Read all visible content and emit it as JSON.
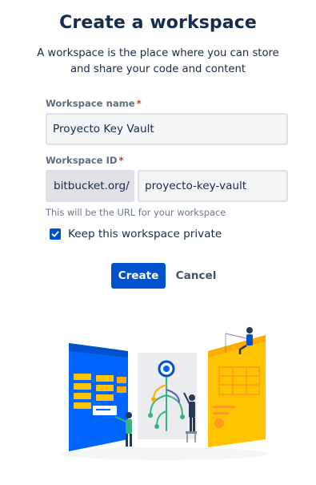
{
  "page": {
    "title": "Create a workspace",
    "subtitle": "A workspace is the place where you can store and share your code and content"
  },
  "form": {
    "name": {
      "label": "Workspace name",
      "required_marker": "*",
      "value": "Proyecto Key Vault"
    },
    "id": {
      "label": "Workspace ID",
      "required_marker": "*",
      "prefix": "bitbucket.org/",
      "value": "proyecto-key-vault",
      "helper": "This will be the URL for your workspace"
    },
    "private": {
      "label": "Keep this workspace private",
      "checked": true
    }
  },
  "actions": {
    "create_label": "Create",
    "cancel_label": "Cancel"
  },
  "colors": {
    "primary": "#0052cc",
    "text": "#172b4d",
    "required": "#de350b",
    "field_bg": "#f4f5f7"
  },
  "illustration": {
    "name": "workspace-illustration"
  }
}
